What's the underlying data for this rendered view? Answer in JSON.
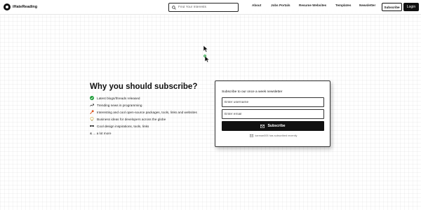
{
  "header": {
    "logo_text": "iHateReading",
    "search_placeholder": "Find Your Interests",
    "nav": [
      "About",
      "Jobs Portals",
      "Resume Websites",
      "Templates",
      "Newsletter"
    ],
    "subscribe_label": "Subscribe",
    "login_label": "Login"
  },
  "main": {
    "headline": "Why you should subscribe?",
    "features": [
      {
        "icon": "check-circle-icon",
        "text": "Latest blogs/threads released"
      },
      {
        "icon": "trending-up-icon",
        "text": "Trending news in programming"
      },
      {
        "icon": "key-icon",
        "text": "Interesting and cool open-source packages, tools, links and websites"
      },
      {
        "icon": "lightbulb-icon",
        "text": "Business ideas for developers across the globe"
      },
      {
        "icon": "glasses-icon",
        "text": "Cool design inspirations, tools, links"
      }
    ],
    "more_text": "& ... a lot more"
  },
  "card": {
    "title": "Subscribe to our once a week newsletter",
    "username_placeholder": "Enter username",
    "email_placeholder": "Enter email",
    "button_label": "Subscribe",
    "recent_text": "karman005 has subscribed recently"
  },
  "colors": {
    "accent": "#111111",
    "check": "#1f9d3a",
    "key": "#d9541e"
  }
}
